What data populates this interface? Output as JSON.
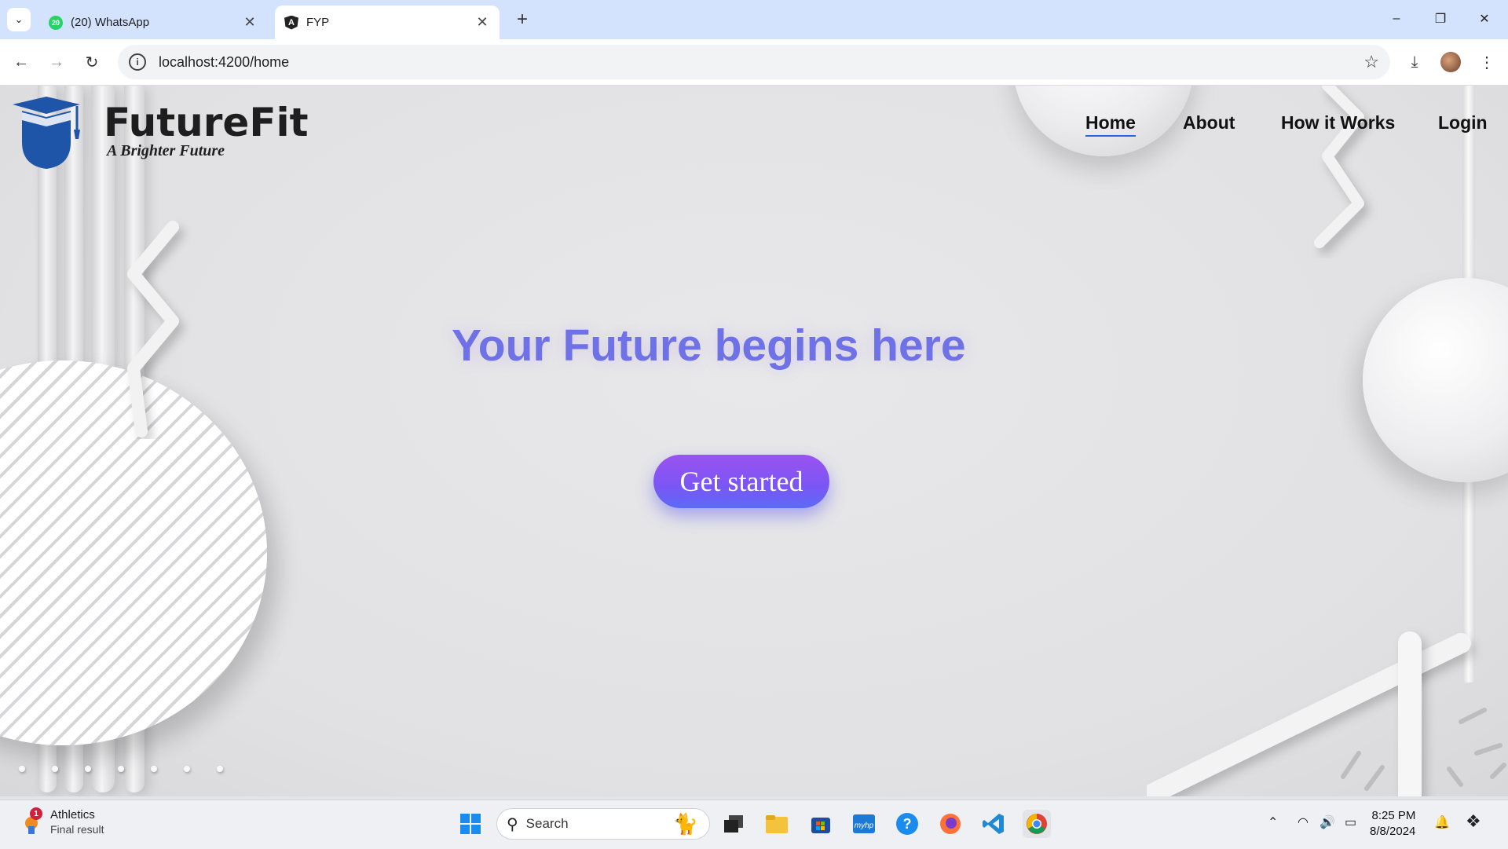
{
  "browser": {
    "tabs": [
      {
        "title": "(20) WhatsApp",
        "badge": "20",
        "active": false
      },
      {
        "title": "FYP",
        "active": true
      }
    ],
    "new_tab_symbol": "+",
    "url": "localhost:4200/home",
    "window_controls": {
      "minimize": "–",
      "restore": "❐",
      "close": "✕"
    }
  },
  "site": {
    "brand": "FutureFit",
    "tagline": "A Brighter Future",
    "nav": [
      {
        "label": "Home",
        "active": true
      },
      {
        "label": "About",
        "active": false
      },
      {
        "label": "How it Works",
        "active": false
      },
      {
        "label": "Login",
        "active": false
      }
    ],
    "hero_title": "Your Future begins here",
    "cta_label": "Get started",
    "colors": {
      "hero_text": "#6f72e6",
      "cta_start": "#9b52f0",
      "cta_end": "#5b6bf8",
      "nav_underline": "#2563eb",
      "logo_blue": "#1f55a8"
    }
  },
  "taskbar": {
    "widget": {
      "badge": "1",
      "title": "Athletics",
      "subtitle": "Final result"
    },
    "search_placeholder": "Search",
    "apps": [
      "windows-start-icon",
      "task-view-icon",
      "file-explorer-icon",
      "microsoft-store-icon",
      "myhp-icon",
      "help-icon",
      "firefox-icon",
      "vscode-icon",
      "chrome-icon"
    ],
    "clock": {
      "time": "8:25 PM",
      "date": "8/8/2024"
    }
  }
}
